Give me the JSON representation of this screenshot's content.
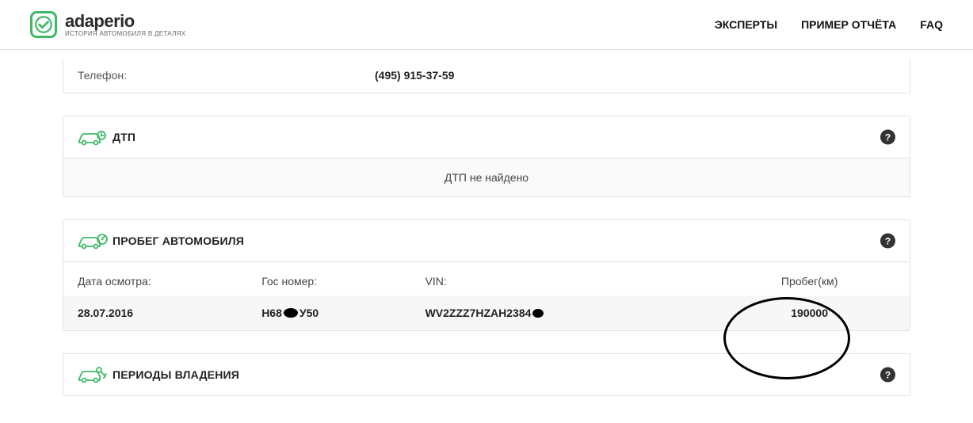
{
  "header": {
    "logo_title": "adaperio",
    "logo_sub": "ИСТОРИЯ АВТОМОБИЛЯ В ДЕТАЛЯХ",
    "nav": {
      "experts": "ЭКСПЕРТЫ",
      "sample": "ПРИМЕР ОТЧЁТА",
      "faq": "FAQ"
    }
  },
  "phone": {
    "label": "Телефон:",
    "value": "(495) 915-37-59"
  },
  "dtp": {
    "title": "ДТП",
    "empty_text": "ДТП не найдено"
  },
  "mileage": {
    "title": "ПРОБЕГ АВТОМОБИЛЯ",
    "columns": {
      "date": "Дата осмотра:",
      "plate": "Гос номер:",
      "vin": "VIN:",
      "mileage": "Пробег(км)"
    },
    "row": {
      "date": "28.07.2016",
      "plate_prefix": "Н68",
      "plate_suffix": "У50",
      "vin_prefix": "WV2ZZZ7HZAH2384",
      "mileage": "190000"
    }
  },
  "ownership": {
    "title": "ПЕРИОДЫ ВЛАДЕНИЯ"
  }
}
